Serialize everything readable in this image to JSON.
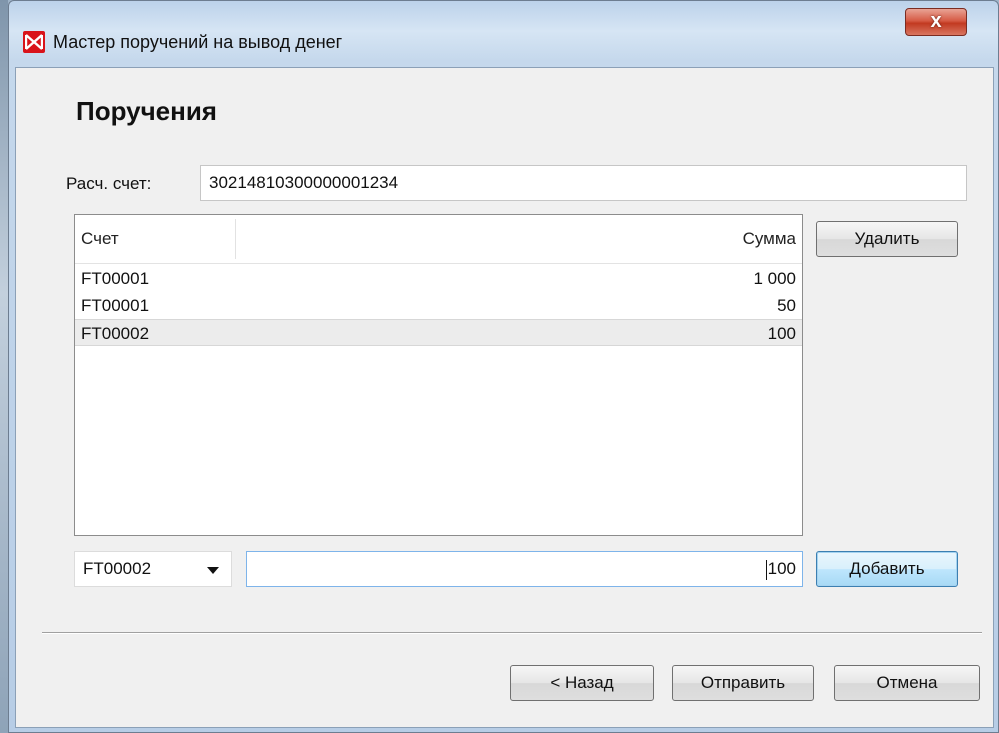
{
  "window": {
    "title": "Мастер поручений на вывод денег",
    "close_label": "x",
    "icon": "moex-logo-icon",
    "close_color": "#c8432c"
  },
  "page": {
    "title": "Поручения",
    "account_label": "Расч. счет:",
    "account_value": "30214810300000001234"
  },
  "table": {
    "headers": {
      "account": "Счет",
      "amount": "Сумма"
    },
    "rows": [
      {
        "account": "FT00001",
        "amount": "1 000",
        "selected": false
      },
      {
        "account": "FT00001",
        "amount": "50",
        "selected": false
      },
      {
        "account": "FT00002",
        "amount": "100",
        "selected": true
      }
    ]
  },
  "buttons": {
    "delete": "Удалить",
    "add": "Добавить",
    "back": "< Назад",
    "send": "Отправить",
    "cancel": "Отмена"
  },
  "entry": {
    "selected_account": "FT00002",
    "amount_value": "100"
  }
}
